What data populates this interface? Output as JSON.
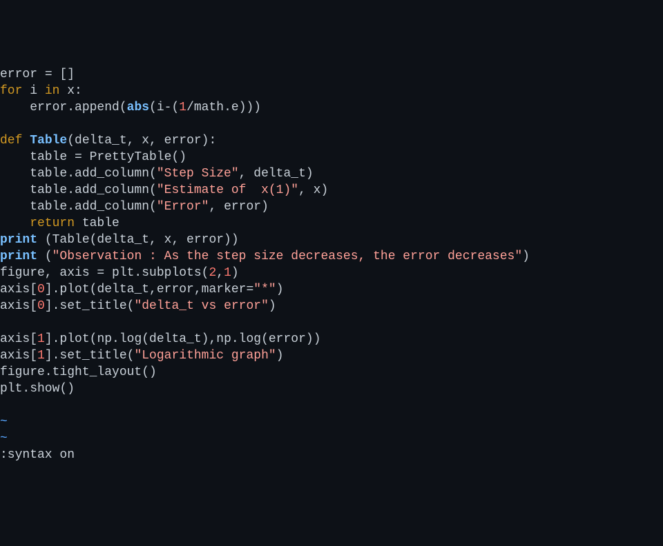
{
  "lines": {
    "l1_error": "error",
    "l1_eq": " = []",
    "l2_for": "for",
    "l2_i": " i ",
    "l2_in": "in",
    "l2_x": " x:",
    "l3_indent": "    error.append(",
    "l3_abs": "abs",
    "l3_open": "(i-(",
    "l3_one": "1",
    "l3_rest": "/math.e)))",
    "l5_def": "def",
    "l5_sp": " ",
    "l5_name": "Table",
    "l5_params": "(delta_t, x, error):",
    "l6": "    table = PrettyTable()",
    "l7_a": "    table.add_column(",
    "l7_s": "\"Step Size\"",
    "l7_b": ", delta_t)",
    "l8_a": "    table.add_column(",
    "l8_s": "\"Estimate of  x(1)\"",
    "l8_b": ", x)",
    "l9_a": "    table.add_column(",
    "l9_s": "\"Error\"",
    "l9_b": ", error)",
    "l10_ret": "    return",
    "l10_tab": " table",
    "l11_print": "print",
    "l11_rest": " (Table(delta_t, x, error))",
    "l12_print": "print",
    "l12_open": " (",
    "l12_str": "\"Observation : As the step size decreases, the error decreases\"",
    "l12_close": ")",
    "l13_a": "figure, axis = plt.subplots(",
    "l13_two": "2",
    "l13_comma": ",",
    "l13_one": "1",
    "l13_close": ")",
    "l14_a": "axis[",
    "l14_zero": "0",
    "l14_b": "].plot(delta_t,error,marker=",
    "l14_star": "\"*\"",
    "l14_close": ")",
    "l15_a": "axis[",
    "l15_zero": "0",
    "l15_b": "].set_title(",
    "l15_str": "\"delta_t vs error\"",
    "l15_close": ")",
    "l17_a": "axis[",
    "l17_one": "1",
    "l17_b": "].plot(np.log(delta_t),np.log(error))",
    "l18_a": "axis[",
    "l18_one": "1",
    "l18_b": "].set_title(",
    "l18_str": "\"Logarithmic graph\"",
    "l18_close": ")",
    "l19": "figure.tight_layout()",
    "l20": "plt.show()",
    "tilde": "~",
    "status": ":syntax on"
  }
}
